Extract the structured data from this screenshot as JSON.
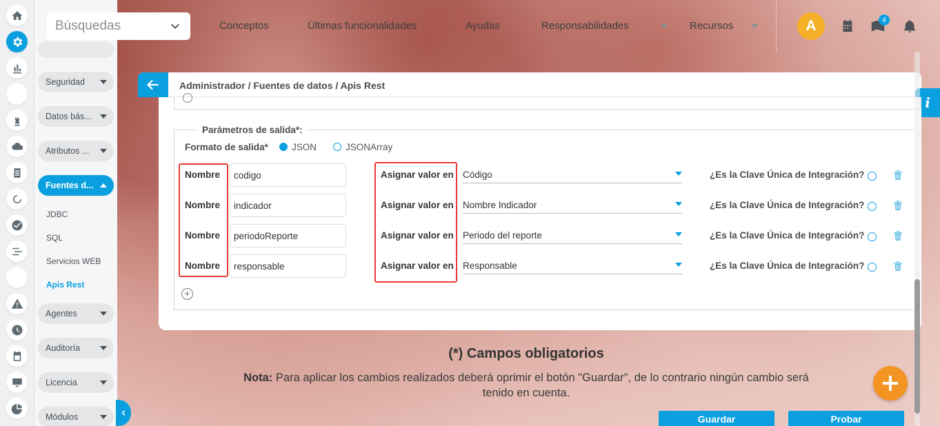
{
  "topbar": {
    "search_placeholder": "Búsquedas",
    "nav": [
      "Conceptos",
      "Últimas funcionalidades",
      "Ayudas",
      "Responsabilidades",
      "Recursos"
    ],
    "avatar_letter": "A",
    "notifications_count": "4"
  },
  "rail": {
    "icons": [
      "home-icon",
      "gear-icon",
      "chart-icon",
      "blank-icon",
      "chess-icon",
      "cloud-icon",
      "document-icon",
      "cycle-icon",
      "check-icon",
      "list-icon",
      "blank-icon",
      "alert-icon",
      "clock-icon",
      "calendar-icon",
      "monitor-icon",
      "pie-icon"
    ]
  },
  "menu": {
    "items": [
      {
        "label": "Seguridad"
      },
      {
        "label": "Datos bás..."
      },
      {
        "label": "Atributos ..."
      },
      {
        "label": "Fuentes d..."
      },
      {
        "label": "Agentes"
      },
      {
        "label": "Auditoría"
      },
      {
        "label": "Licencia"
      },
      {
        "label": "Módulos"
      }
    ],
    "subitems": [
      "JDBC",
      "SQL",
      "Servicios WEB",
      "Apis Rest"
    ]
  },
  "panel": {
    "breadcrumb": "Administrador / Fuentes de datos / Apis Rest",
    "info_label": "i",
    "output_legend": "Parámetros de salida*:",
    "format_label": "Formato de salida*",
    "format_options": [
      "JSON",
      "JSONArray"
    ],
    "format_selected": "JSON",
    "name_label": "Nombre",
    "assign_label": "Asignar valor en",
    "clave_label": "¿Es la Clave Única de Integración?",
    "rows": [
      {
        "name": "codigo",
        "assign": "Código"
      },
      {
        "name": "indicador",
        "assign": "Nombre Indicador"
      },
      {
        "name": "periodoReporte",
        "assign": "Periodo del reporte"
      },
      {
        "name": "responsable",
        "assign": "Responsable"
      }
    ]
  },
  "footer": {
    "required_title": "(*) Campos obligatorios",
    "note_prefix": "Nota:",
    "note_text": " Para aplicar los cambios realizados deberá oprimir el botón \"Guardar\", de lo contrario ningún cambio será tenido en cuenta.",
    "save_label": "Guardar",
    "test_label": "Probar"
  },
  "colors": {
    "accent": "#0aa0e0",
    "highlight": "#e53935",
    "fab": "#f39423",
    "avatar": "#f5b027"
  }
}
